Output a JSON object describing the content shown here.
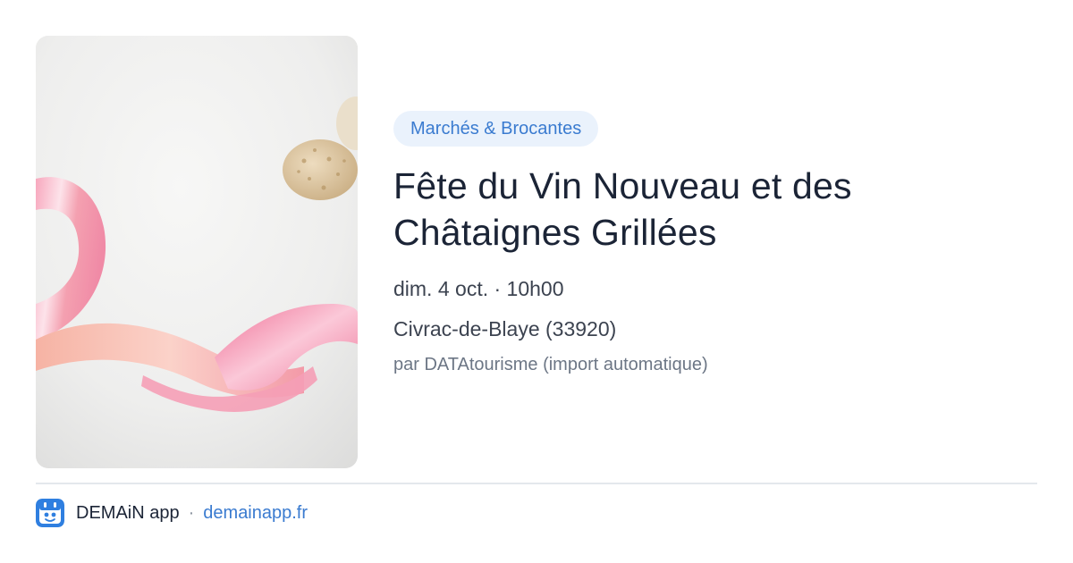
{
  "event": {
    "category": "Marchés & Brocantes",
    "title_line1": "Fête du Vin Nouveau et des",
    "title_line2": "Châtaignes Grillées",
    "date": "dim. 4 oct. · 10h00",
    "location": "Civrac-de-Blaye (33920)",
    "source": "par DATAtourisme (import automatique)"
  },
  "footer": {
    "app_name": "DEMAiN app",
    "separator": "·",
    "site": "demainapp.fr"
  },
  "colors": {
    "accent": "#3a7bd0",
    "chip_background": "#eaf2fc",
    "title": "#1b2436",
    "meta": "#3c4350",
    "muted": "#6c7685",
    "divider": "#e4e8ec"
  },
  "icons": {
    "app_logo": "app-logo-icon"
  }
}
